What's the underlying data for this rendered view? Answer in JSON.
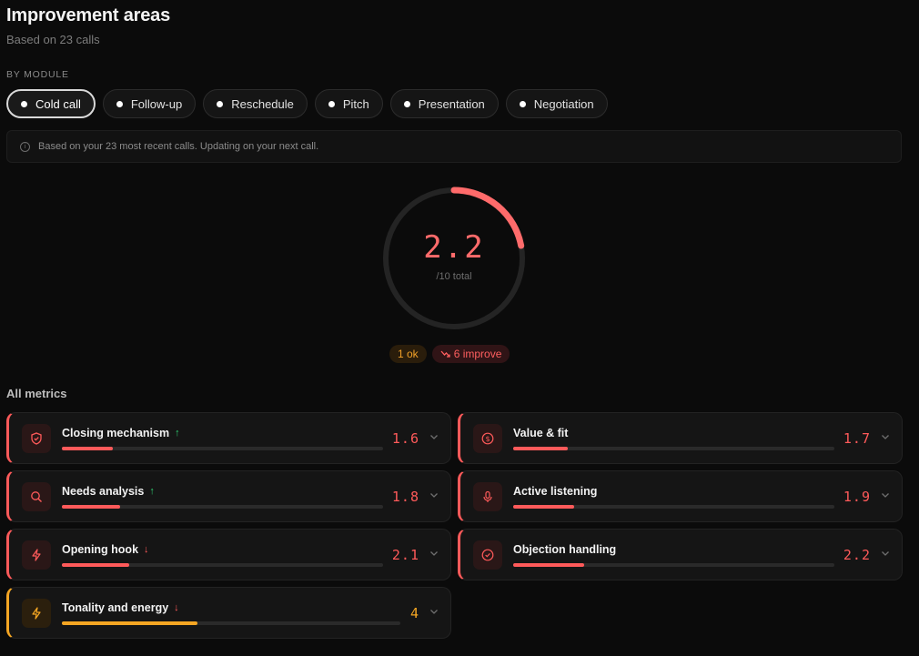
{
  "header": {
    "title": "Improvement areas",
    "subtitle": "Based on 23 calls"
  },
  "modules_label": "BY MODULE",
  "modules": [
    {
      "label": "Cold call",
      "active": true
    },
    {
      "label": "Follow-up",
      "active": false
    },
    {
      "label": "Reschedule",
      "active": false
    },
    {
      "label": "Pitch",
      "active": false
    },
    {
      "label": "Presentation",
      "active": false
    },
    {
      "label": "Negotiation",
      "active": false
    }
  ],
  "info": {
    "text": "Based on your 23 most recent calls. Updating on your next call.",
    "icon": "info-icon"
  },
  "overall": {
    "score": "2.2",
    "total_label": "/10 total",
    "fraction": 0.22,
    "color": "#ff6b6b"
  },
  "badges": {
    "ok": "1 ok",
    "improve": "6 improve"
  },
  "metrics_label": "All metrics",
  "metrics": [
    {
      "name": "Closing mechanism",
      "score": "1.6",
      "trend": "up",
      "icon": "shield-icon",
      "fraction": 0.16,
      "status": "improve"
    },
    {
      "name": "Value & fit",
      "score": "1.7",
      "trend": "none",
      "icon": "dollar-icon",
      "fraction": 0.17,
      "status": "improve"
    },
    {
      "name": "Needs analysis",
      "score": "1.8",
      "trend": "up",
      "icon": "search-icon",
      "fraction": 0.18,
      "status": "improve"
    },
    {
      "name": "Active listening",
      "score": "1.9",
      "trend": "none",
      "icon": "microphone-icon",
      "fraction": 0.19,
      "status": "improve"
    },
    {
      "name": "Opening hook",
      "score": "2.1",
      "trend": "down",
      "icon": "lightning-icon",
      "fraction": 0.21,
      "status": "improve"
    },
    {
      "name": "Objection handling",
      "score": "2.2",
      "trend": "none",
      "icon": "check-circle-icon",
      "fraction": 0.22,
      "status": "improve"
    },
    {
      "name": "Tonality and energy",
      "score": "4",
      "trend": "down",
      "icon": "lightning-icon",
      "fraction": 0.4,
      "status": "ok"
    }
  ],
  "colors": {
    "improve": "#ff5a5a",
    "ok": "#f5a623",
    "trend_up": "#2ecc71",
    "trend_down": "#ff5a5a"
  }
}
